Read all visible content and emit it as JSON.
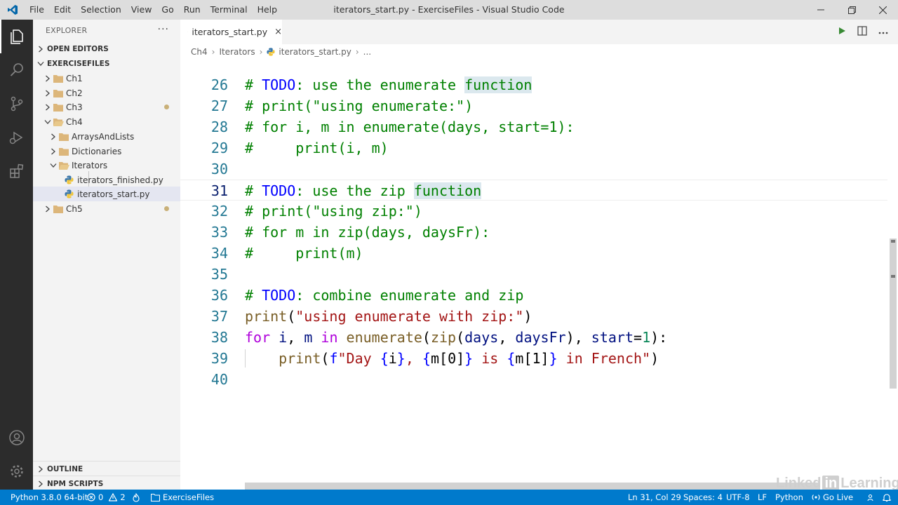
{
  "window": {
    "title": "iterators_start.py - ExerciseFiles - Visual Studio Code",
    "menu": [
      "File",
      "Edit",
      "Selection",
      "View",
      "Go",
      "Run",
      "Terminal",
      "Help"
    ]
  },
  "sidebar": {
    "title": "EXPLORER",
    "more": "···",
    "open_editors": "OPEN EDITORS",
    "workspace": "EXERCISEFILES",
    "tree": [
      {
        "label": "Ch1",
        "type": "folder",
        "expanded": false,
        "modified": false
      },
      {
        "label": "Ch2",
        "type": "folder",
        "expanded": false,
        "modified": false
      },
      {
        "label": "Ch3",
        "type": "folder",
        "expanded": false,
        "modified": true
      },
      {
        "label": "Ch4",
        "type": "folder",
        "expanded": true,
        "modified": false
      },
      {
        "label": "ArraysAndLists",
        "type": "folder",
        "expanded": false,
        "modified": false
      },
      {
        "label": "Dictionaries",
        "type": "folder",
        "expanded": false,
        "modified": false
      },
      {
        "label": "Iterators",
        "type": "folder",
        "expanded": true,
        "modified": false
      },
      {
        "label": "iterators_finished.py",
        "type": "python",
        "modified": false
      },
      {
        "label": "iterators_start.py",
        "type": "python",
        "selected": true,
        "modified": false
      },
      {
        "label": "Ch5",
        "type": "folder",
        "expanded": false,
        "modified": true
      }
    ],
    "outline": "OUTLINE",
    "npm": "NPM SCRIPTS"
  },
  "editor": {
    "tab": {
      "label": "iterators_start.py",
      "close": "×"
    },
    "breadcrumb": [
      "Ch4",
      "Iterators",
      "iterators_start.py",
      "..."
    ],
    "lines": [
      {
        "n": "26",
        "text": "# TODO: use the enumerate function"
      },
      {
        "n": "27",
        "text": "# print(\"using enumerate:\")"
      },
      {
        "n": "28",
        "text": "# for i, m in enumerate(days, start=1):"
      },
      {
        "n": "29",
        "text": "#     print(i, m)"
      },
      {
        "n": "30",
        "text": ""
      },
      {
        "n": "31",
        "text": "# TODO: use the zip function"
      },
      {
        "n": "32",
        "text": "# print(\"using zip:\")"
      },
      {
        "n": "33",
        "text": "# for m in zip(days, daysFr):"
      },
      {
        "n": "34",
        "text": "#     print(m)"
      },
      {
        "n": "35",
        "text": ""
      },
      {
        "n": "36",
        "text": "# TODO: combine enumerate and zip"
      },
      {
        "n": "37",
        "text": "print(\"using enumerate with zip:\")"
      },
      {
        "n": "38",
        "text": "for i, m in enumerate(zip(days, daysFr), start=1):"
      },
      {
        "n": "39",
        "text": "    print(f\"Day {i}, {m[0]} is {m[1]} in French\")"
      },
      {
        "n": "40",
        "text": ""
      }
    ]
  },
  "statusbar": {
    "python": "Python 3.8.0 64-bit",
    "errors": "0",
    "warnings": "2",
    "folder": "ExerciseFiles",
    "position": "Ln 31, Col 29",
    "spaces": "Spaces: 4",
    "encoding": "UTF-8",
    "eol": "LF",
    "language": "Python",
    "golive": "Go Live"
  },
  "watermark": {
    "pre": "Linked",
    "mid": "in",
    "post": "Learning"
  },
  "colors": {
    "accent": "#007acc",
    "activity": "#2c2c2c",
    "sidebar": "#f3f3f3",
    "titlebar": "#dddddd"
  }
}
